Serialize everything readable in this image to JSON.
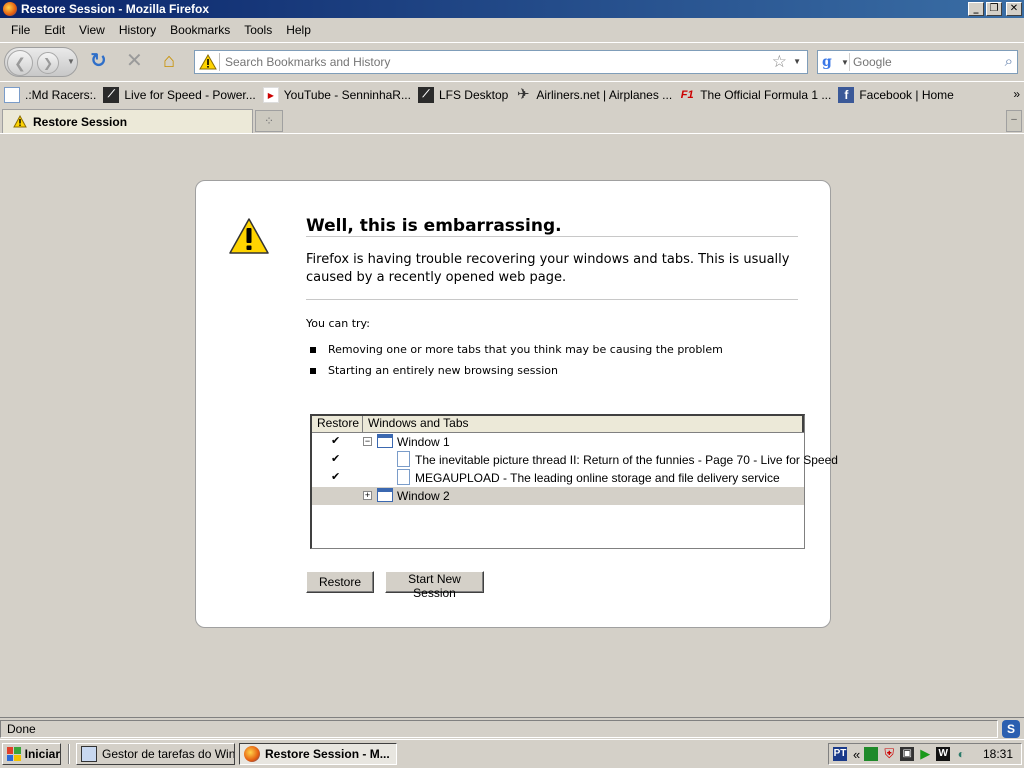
{
  "window": {
    "title": "Restore Session - Mozilla Firefox"
  },
  "menu": [
    "File",
    "Edit",
    "View",
    "History",
    "Bookmarks",
    "Tools",
    "Help"
  ],
  "navbar": {
    "url_placeholder": "Search Bookmarks and History",
    "search_placeholder": "Google",
    "search_engine_icon": "google-icon"
  },
  "bookmarks": [
    {
      "label": ".:Md Racers:.",
      "icon": "page-icon"
    },
    {
      "label": "Live for Speed - Power...",
      "icon": "lfs-icon"
    },
    {
      "label": "YouTube - SenninhaR...",
      "icon": "youtube-icon"
    },
    {
      "label": "LFS Desktop",
      "icon": "lfs-icon"
    },
    {
      "label": "Airliners.net | Airplanes ...",
      "icon": "airplane-icon"
    },
    {
      "label": "The Official Formula 1 ...",
      "icon": "f1-icon"
    },
    {
      "label": "Facebook | Home",
      "icon": "facebook-icon"
    }
  ],
  "bookmarks_more": "»",
  "tab": {
    "label": "Restore Session"
  },
  "page": {
    "title": "Well, this is embarrassing.",
    "description": "Firefox is having trouble recovering your windows and tabs. This is usually caused by a recently opened web page.",
    "try_label": "You can try:",
    "suggestions": [
      "Removing one or more tabs that you think may be causing the problem",
      "Starting an entirely new browsing session"
    ],
    "tree": {
      "col_restore": "Restore",
      "col_windows": "Windows and Tabs",
      "rows": [
        {
          "label": "Window 1",
          "checked": "✔",
          "kind": "window",
          "expanded": true
        },
        {
          "label": "The inevitable picture thread II: Return of the funnies - Page 70 - Live for Speed",
          "checked": "✔",
          "kind": "tab"
        },
        {
          "label": "MEGAUPLOAD - The leading online storage and file delivery service",
          "checked": "✔",
          "kind": "tab"
        },
        {
          "label": "Window 2",
          "checked": "",
          "kind": "window",
          "expanded": false
        }
      ]
    },
    "btn_restore": "Restore",
    "btn_new_session": "Start New Session"
  },
  "status": {
    "text": "Done"
  },
  "taskbar": {
    "start": "Iniciar",
    "tasks": [
      {
        "label": "Gestor de tarefas do Win...",
        "active": false
      },
      {
        "label": "Restore Session - M...",
        "active": true
      }
    ],
    "clock": "18:31",
    "tray_chevron": "«"
  },
  "colors": {
    "titlebar_start": "#0a246a",
    "titlebar_end": "#3a6ea5",
    "warning_yellow": "#ffd400"
  }
}
